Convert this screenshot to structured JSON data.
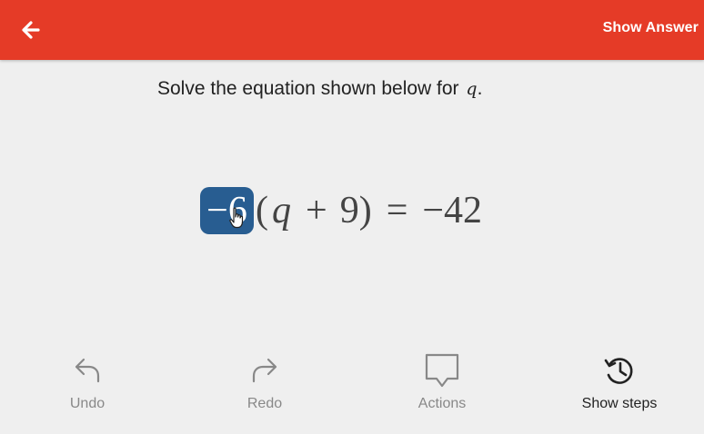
{
  "header": {
    "back_icon": "arrow-left-icon",
    "show_answer_label": "Show Answer",
    "color": "#e53b27"
  },
  "prompt": {
    "text": "Solve the equation shown below for",
    "variable": "q",
    "period": "."
  },
  "equation": {
    "coefficient": "−6",
    "open_paren": "(",
    "variable": "q",
    "plus": "+",
    "nine": "9",
    "close_paren": ")",
    "equals": "=",
    "rhs": "−42",
    "selected_term": "−6",
    "selection_color": "#285d91"
  },
  "toolbar": {
    "undo_label": "Undo",
    "redo_label": "Redo",
    "actions_label": "Actions",
    "show_steps_label": "Show steps",
    "undo_icon": "undo-arrow-icon",
    "redo_icon": "redo-arrow-icon",
    "actions_icon": "speech-bubble-icon",
    "show_steps_icon": "history-clock-icon"
  }
}
